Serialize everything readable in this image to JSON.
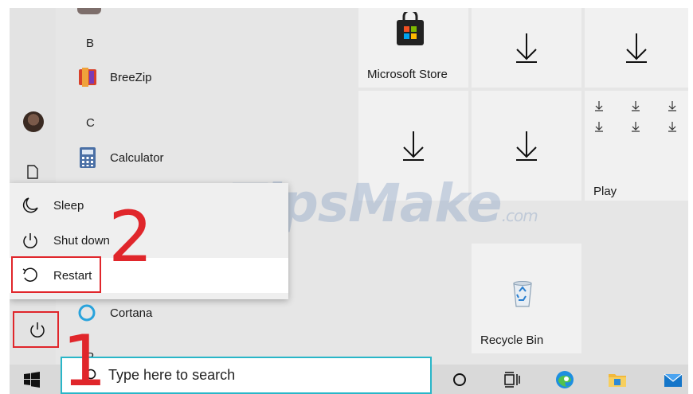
{
  "app_list": {
    "letter_b": "B",
    "letter_c": "C",
    "letter_p": "P",
    "breezip": "BreeZip",
    "calculator": "Calculator",
    "cortana": "Cortana"
  },
  "power_menu": {
    "sleep": "Sleep",
    "shutdown": "Shut down",
    "restart": "Restart"
  },
  "tiles": {
    "microsoft_store": "Microsoft Store",
    "play": "Play",
    "recycle_bin": "Recycle Bin"
  },
  "taskbar": {
    "search_placeholder": "Type here to search"
  },
  "annotations": {
    "step1": "1",
    "step2": "2",
    "highlight_color": "#e0262b"
  },
  "watermark": {
    "main": "TipsMake",
    "suffix": ".com"
  },
  "colors": {
    "search_border": "#29b6c8",
    "edge_blue": "#1e8fe0",
    "folder_yellow": "#f2b93b"
  }
}
